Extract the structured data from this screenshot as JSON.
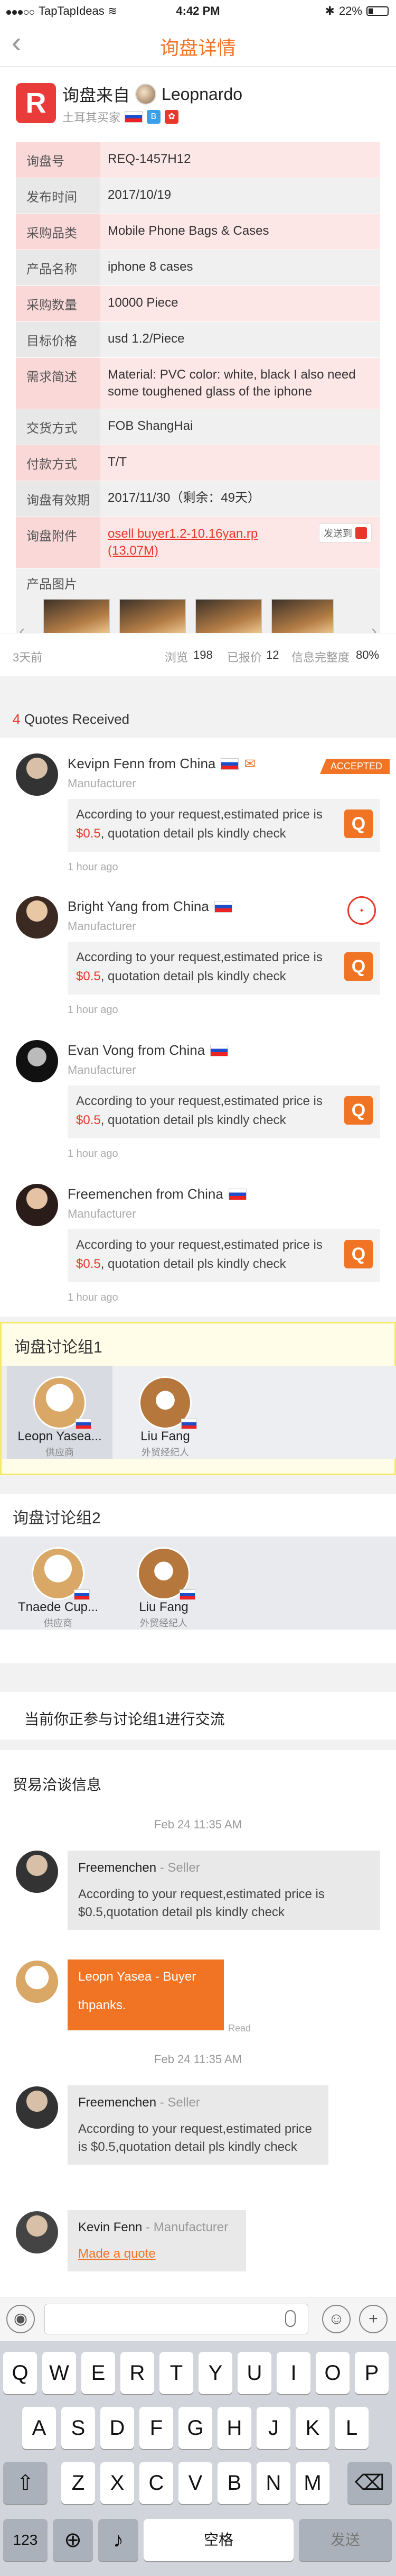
{
  "status_bar": {
    "carrier": "TapTapIdeas",
    "time": "4:42 PM",
    "battery": "22%"
  },
  "nav": {
    "back": "‹",
    "title": "询盘详情"
  },
  "header": {
    "logo_letter": "R",
    "title_prefix": "询盘来自",
    "name": "Leopnardo",
    "subtitle": "土耳其买家",
    "flag": "russia-flag",
    "badges": [
      "B",
      "✿"
    ],
    "badge_colors": [
      "#3aa0e8",
      "#e8382b"
    ]
  },
  "details": [
    {
      "label": "询盘号",
      "value": "REQ-1457H12"
    },
    {
      "label": "发布时间",
      "value": "2017/10/19"
    },
    {
      "label": "采购品类",
      "value": "Mobile Phone Bags & Cases"
    },
    {
      "label": "产品名称",
      "value": "iphone 8 cases"
    },
    {
      "label": "采购数量",
      "value": "10000 Piece"
    },
    {
      "label": "目标价格",
      "value": "usd 1.2/Piece"
    },
    {
      "label": "需求简述",
      "value": "Material: PVC color: white, black I also need some toughened glass of the iphone"
    },
    {
      "label": "交货方式",
      "value": "FOB ShangHai"
    },
    {
      "label": "付款方式",
      "value": "T/T"
    },
    {
      "label": "询盘有效期",
      "value": "2017/11/30（剩余：49天）"
    },
    {
      "label": "询盘附件",
      "value": "osell buyer1.2-10.16yan.rp (13.07M)",
      "action": "发送到"
    }
  ],
  "photos": {
    "label": "产品图片",
    "prev": "‹",
    "next": "›"
  },
  "stats": {
    "age": "3天前",
    "views_label": "浏览",
    "views": "198",
    "quoted_label": "已报价",
    "quoted": "12",
    "completeness_label": "信息完整度",
    "completeness": "80%"
  },
  "quotes": {
    "count": "4",
    "heading": "Quotes Received",
    "items": [
      {
        "name": "Kevipn Fenn from China",
        "role": "Manufacturer",
        "text_pre": "According to your request,estimated price is ",
        "price": "$0.5",
        "text_post": ", quotation detail pls kindly check",
        "time": "1 hour ago",
        "tag": "ACCEPTED"
      },
      {
        "name": "Bright Yang from China",
        "role": "Manufacturer",
        "text_pre": "According to your request,estimated price is ",
        "price": "$0.5",
        "text_post": ", quotation detail pls kindly check",
        "time": "1 hour ago"
      },
      {
        "name": "Evan Vong from China",
        "role": "Manufacturer",
        "text_pre": "According to your request,estimated price is ",
        "price": "$0.5",
        "text_post": ", quotation detail pls kindly check",
        "time": "1 hour ago"
      },
      {
        "name": "Freemenchen from China",
        "role": "Manufacturer",
        "text_pre": "According to your request,estimated price is ",
        "price": "$0.5",
        "text_post": ", quotation detail pls kindly check",
        "time": "1 hour ago"
      }
    ],
    "button_letter": "Q"
  },
  "groups": [
    {
      "title": "询盘讨论组1",
      "members": [
        {
          "name": "Leopn Yasea...",
          "role": "供应商"
        },
        {
          "name": "Liu Fang",
          "role": "外贸经纪人"
        }
      ]
    },
    {
      "title": "询盘讨论组2",
      "members": [
        {
          "name": "Tnaede Cup...",
          "role": "供应商"
        },
        {
          "name": "Liu Fang",
          "role": "外贸经纪人"
        }
      ]
    }
  ],
  "notice": "当前你正参与讨论组1进行交流",
  "trade": {
    "title": "贸易洽谈信息",
    "date1": "Feb 24 11:35 AM",
    "date2": "Feb 24 11:35 AM",
    "messages": [
      {
        "name": "Freemenchen",
        "role": " - Seller",
        "text": "According to your request,estimated price is $0.5,quotation detail pls kindly check"
      },
      {
        "name": "Leopn Yasea",
        "role": " - Buyer",
        "text": "thpanks.",
        "read": "Read"
      },
      {
        "name": "Freemenchen",
        "role": " - Seller",
        "text": "According to your request,estimated price is $0.5,quotation detail pls kindly check"
      },
      {
        "name": "Kevin Fenn",
        "role": " - Manufacturer",
        "link": "Made a quote"
      }
    ]
  },
  "input": {
    "placeholder": ""
  },
  "keyboard": {
    "row1": [
      "Q",
      "W",
      "E",
      "R",
      "T",
      "Y",
      "U",
      "I",
      "O",
      "P"
    ],
    "row2": [
      "A",
      "S",
      "D",
      "F",
      "G",
      "H",
      "J",
      "K",
      "L"
    ],
    "row3": [
      "Z",
      "X",
      "C",
      "V",
      "B",
      "N",
      "M"
    ],
    "numbers": "123",
    "space": "空格",
    "send": "发送"
  },
  "colors": {
    "accent": "#f07423",
    "danger": "#e8382b"
  }
}
